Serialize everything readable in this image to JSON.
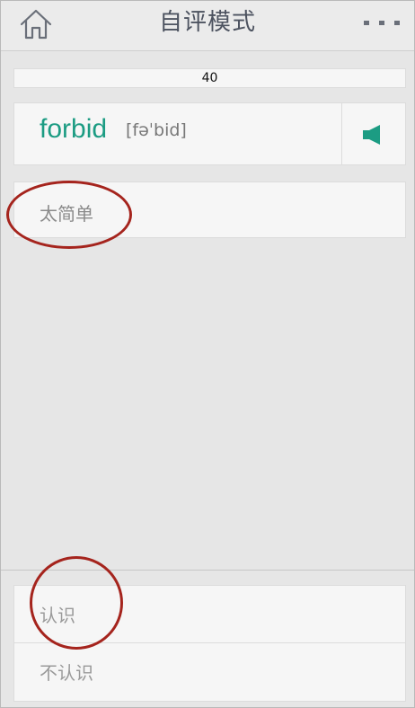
{
  "header": {
    "title": "自评模式",
    "home_icon": "home-icon",
    "more_icon": "more-dots-icon"
  },
  "progress": {
    "value": "40"
  },
  "word_card": {
    "word": "forbid",
    "phonetic": "[fəˈbid]",
    "sound_icon": "speaker-icon"
  },
  "easy_button": {
    "label": "太简单"
  },
  "options": {
    "know_label": "认识",
    "unknown_label": "不认识"
  },
  "colors": {
    "accent": "#1c9c83",
    "annotation": "#a5241d"
  }
}
